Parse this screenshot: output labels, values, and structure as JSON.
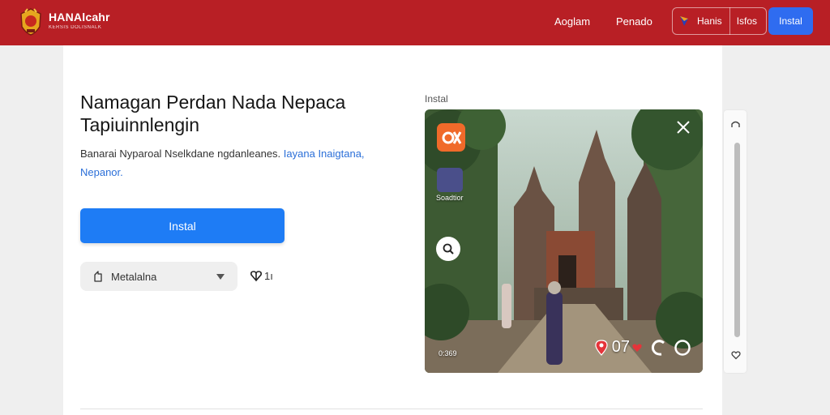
{
  "header": {
    "brand_name": "HANAlcahr",
    "brand_sub": "KERSIS DOLISNALK",
    "nav": [
      "Aoglam",
      "Penado"
    ],
    "pill_a": "Hanis",
    "pill_b": "Isfos",
    "install_label": "Instal",
    "bg_color": "#b81f25",
    "accent_color": "#2f6cf0"
  },
  "main": {
    "title": "Namagan Perdan Nada Nepaca Tapiuinnlengin",
    "desc_text": "Banarai Nyparoal Nselkdane ngdanleanes.",
    "desc_link": "Iayana Inaigtana, Nepanor.",
    "install_label": "Instal",
    "select_value": "Metalalna",
    "rating_value": "1ı",
    "install_color": "#1e7cf5"
  },
  "preview": {
    "label": "Instal",
    "side_label": "Soadtior",
    "counter": "0:369",
    "bottom_count": "07"
  },
  "icons": {
    "logo": "emblem-logo-icon",
    "flag": "flag-icon",
    "select": "copy-icon",
    "rating": "heart-icon",
    "app": "app-logo-icon",
    "close": "close-icon",
    "zoom": "zoom-icon",
    "pin": "map-pin-icon",
    "scroll_up": "chevron-up-icon"
  }
}
